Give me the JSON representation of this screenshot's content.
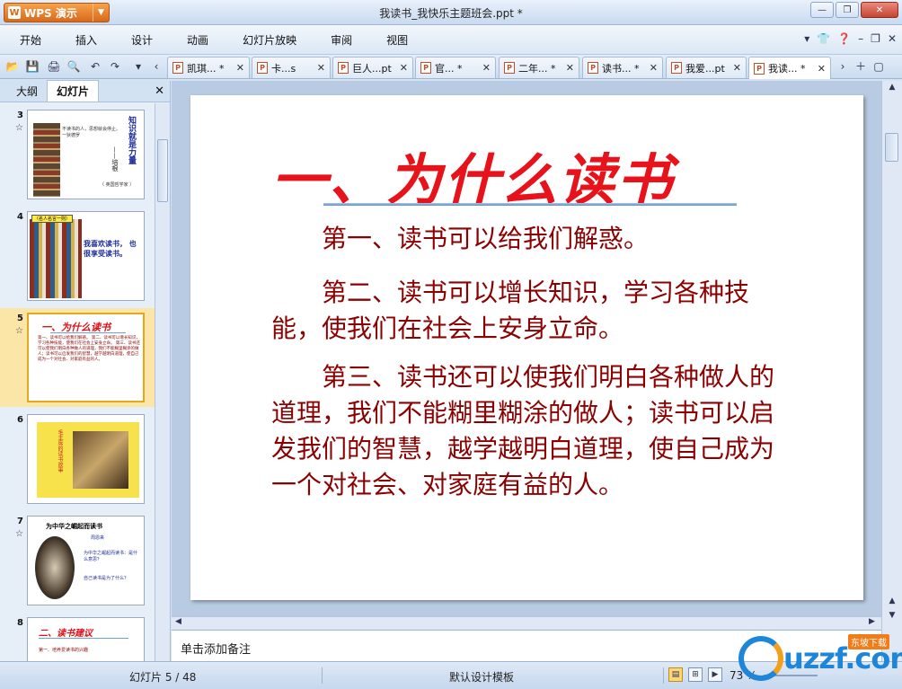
{
  "app": {
    "name": "WPS 演示",
    "window_title": "我读书_我快乐主题班会.ppt *"
  },
  "menu": [
    "开始",
    "插入",
    "设计",
    "动画",
    "幻灯片放映",
    "审阅",
    "视图"
  ],
  "tabs": [
    {
      "label": "凯琪... *"
    },
    {
      "label": "卡...s"
    },
    {
      "label": "巨人...pt"
    },
    {
      "label": "官... *"
    },
    {
      "label": "二年... *"
    },
    {
      "label": "读书... *"
    },
    {
      "label": "我爱...pt"
    },
    {
      "label": "我读... *"
    }
  ],
  "left_panel": {
    "tab_outline": "大纲",
    "tab_slides": "幻灯片",
    "thumbnails": [
      {
        "num": "3",
        "star": "☆",
        "side_text": "知识就是力量",
        "author": "——培根",
        "caption": "不读书的人，思想就会停止。 一狄德罗",
        "extra": "（ 英国哲学家 ）"
      },
      {
        "num": "4",
        "star": "",
        "label": "（名人名言一则）",
        "text": "我喜欢读书， 也很享受读书。"
      },
      {
        "num": "5",
        "star": "☆",
        "title": "一、为什么读书",
        "body": "第一、读书可以给我们解惑。 第二、读书可以增长知识，学习各种技能，使我们在社会上安身立命。 第三、读书还可以使我们明白各种做人的道理，我们不能糊里糊涂的做人；读书可以启发我们的智慧，越学越明白道理，使自己成为一个对社会、对家庭有益的人。"
      },
      {
        "num": "6",
        "star": "",
        "text": "毛主席的读书故事"
      },
      {
        "num": "7",
        "star": "☆",
        "title": "为中华之崛起而读书",
        "sub": "周恩来",
        "b1": "为中华之崛起而读书：是什么意思？",
        "b2": "自己读书是为了什么？"
      },
      {
        "num": "8",
        "star": "",
        "title": "二、读书建议",
        "body": "第一、培养爱读书的兴趣"
      }
    ]
  },
  "slide": {
    "title": "一、为什么读书",
    "para1": "第一、读书可以给我们解惑。",
    "para2": "第二、读书可以增长知识，学习各种技能，使我们在社会上安身立命。",
    "para3": "第三、读书还可以使我们明白各种做人的道理，我们不能糊里糊涂的做人；读书可以启发我们的智慧，越学越明白道理，使自己成为一个对社会、对家庭有益的人。"
  },
  "notes": {
    "placeholder": "单击添加备注"
  },
  "status": {
    "slide_pos": "幻灯片 5 / 48",
    "template": "默认设计模板",
    "zoom": "73 %"
  },
  "watermark": {
    "text": "uzzf.com",
    "tag": "东坡下载"
  }
}
